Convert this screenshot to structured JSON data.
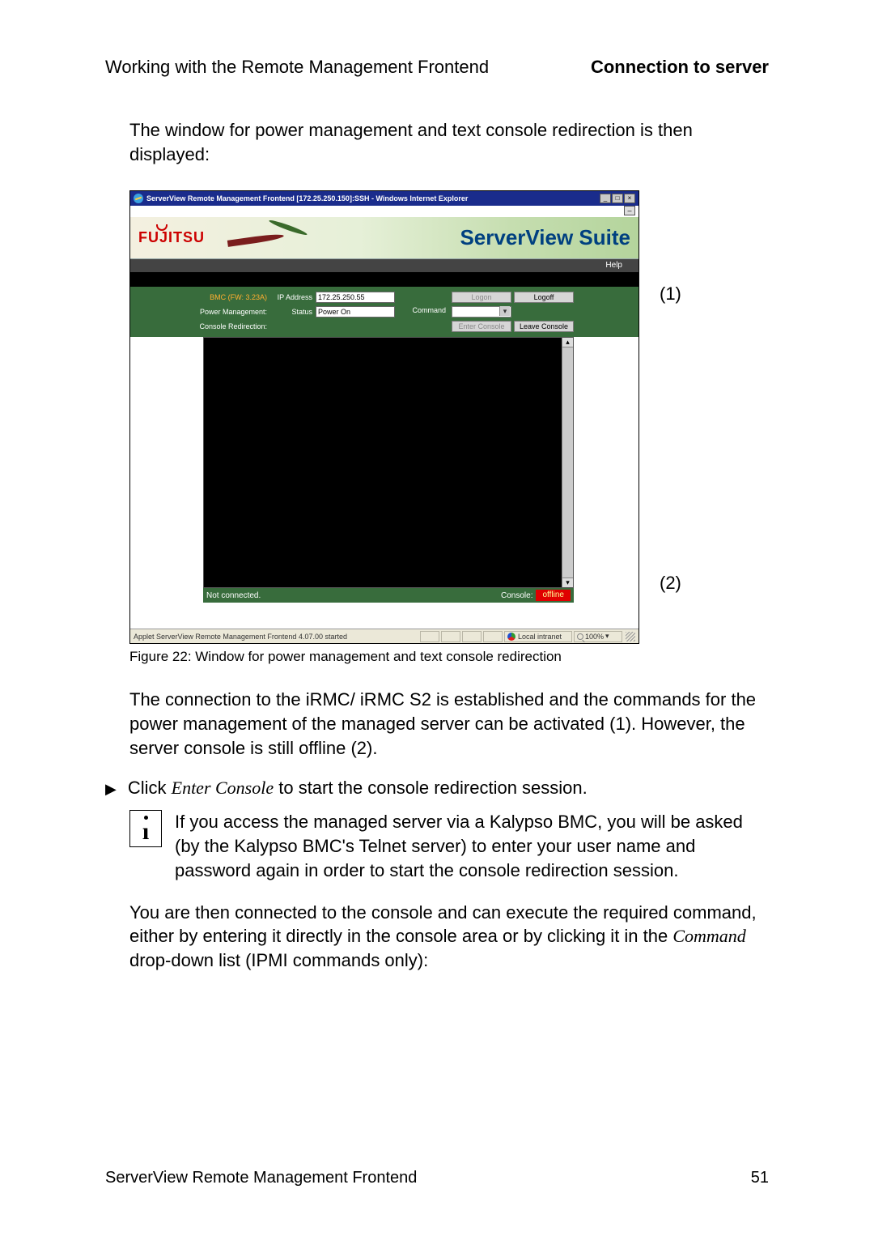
{
  "header": {
    "left": "Working with the Remote Management Frontend",
    "right": "Connection to server"
  },
  "intro": "The window for power management and text console redirection is then displayed:",
  "screenshot": {
    "window_title": "ServerView Remote Management Frontend [172.25.250.150]:SSH - Windows Internet Explorer",
    "collapse_glyph": "–",
    "brand": "FUJITSU",
    "suite": "ServerView Suite",
    "help": "Help",
    "rows": {
      "bmc_label": "BMC (FW: 3.23A)",
      "ip_label": "IP Address",
      "ip_value": "172.25.250.55",
      "logon": "Logon",
      "logoff": "Logoff",
      "pm_label": "Power Management:",
      "status_label": "Status",
      "status_value": "Power On",
      "command_label": "Command",
      "cr_label": "Console Redirection:",
      "enter_console": "Enter Console",
      "leave_console": "Leave Console"
    },
    "statusbar": {
      "left": "Not connected.",
      "console_label": "Console:",
      "console_value": "offline"
    },
    "ie_status": {
      "applet": "Applet ServerView Remote Management Frontend 4.07.00 started",
      "zone": "Local intranet",
      "zoom": "100%",
      "zoom_arrow": "▾"
    },
    "winbtns": {
      "min": "_",
      "max": "□",
      "close": "×"
    }
  },
  "callouts": {
    "one": "(1)",
    "two": "(2)"
  },
  "caption": "Figure 22: Window for power management and text console redirection",
  "para_after": "The connection to the iRMC/ iRMC S2 is established and the commands for the power management of the managed server can be activated (1). However, the server console is still offline (2).",
  "instruction": {
    "pre": "Click ",
    "cmd": "Enter Console",
    "post": " to start the console redirection session."
  },
  "note": "If you access the managed server via a Kalypso BMC, you will be asked (by the Kalypso BMC's Telnet server) to enter your user name and password again in order to start the console redirection session.",
  "para_final": {
    "pre": "You are then connected to the console and can execute the required command, either by entering it directly in the console area or by clicking it in the ",
    "cmd": "Command",
    "post": " drop-down list (IPMI commands only):"
  },
  "footer": {
    "left": "ServerView Remote Management Frontend",
    "page": "51"
  }
}
